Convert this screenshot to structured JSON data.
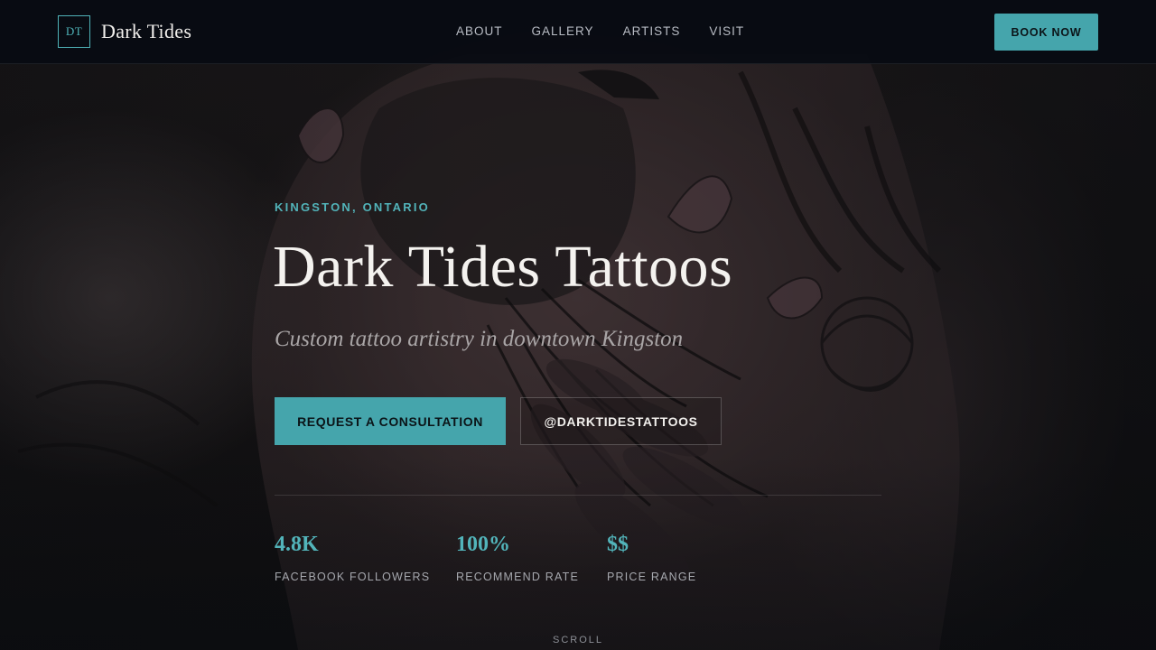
{
  "header": {
    "logo_mark": "DT",
    "logo_text": "Dark Tides",
    "nav": [
      {
        "label": "ABOUT"
      },
      {
        "label": "GALLERY"
      },
      {
        "label": "ARTISTS"
      },
      {
        "label": "VISIT"
      }
    ],
    "cta_label": "BOOK NOW"
  },
  "hero": {
    "eyebrow": "KINGSTON, ONTARIO",
    "title": "Dark Tides Tattoos",
    "subtitle": "Custom tattoo artistry in downtown Kingston",
    "primary_button": "REQUEST A CONSULTATION",
    "secondary_button": "@DARKTIDESTATTOOS",
    "stats": [
      {
        "value": "4.8K",
        "label": "FACEBOOK FOLLOWERS"
      },
      {
        "value": "100%",
        "label": "RECOMMEND RATE"
      },
      {
        "value": "$$",
        "label": "PRICE RANGE"
      }
    ],
    "scroll_hint": "SCROLL"
  },
  "colors": {
    "accent": "#45a5ac",
    "accent_text": "#52b4ba",
    "header_bg": "#080b12",
    "title_text": "#f4f2ef"
  },
  "icons": {
    "hero_background": "tattoo-bird-photo"
  }
}
